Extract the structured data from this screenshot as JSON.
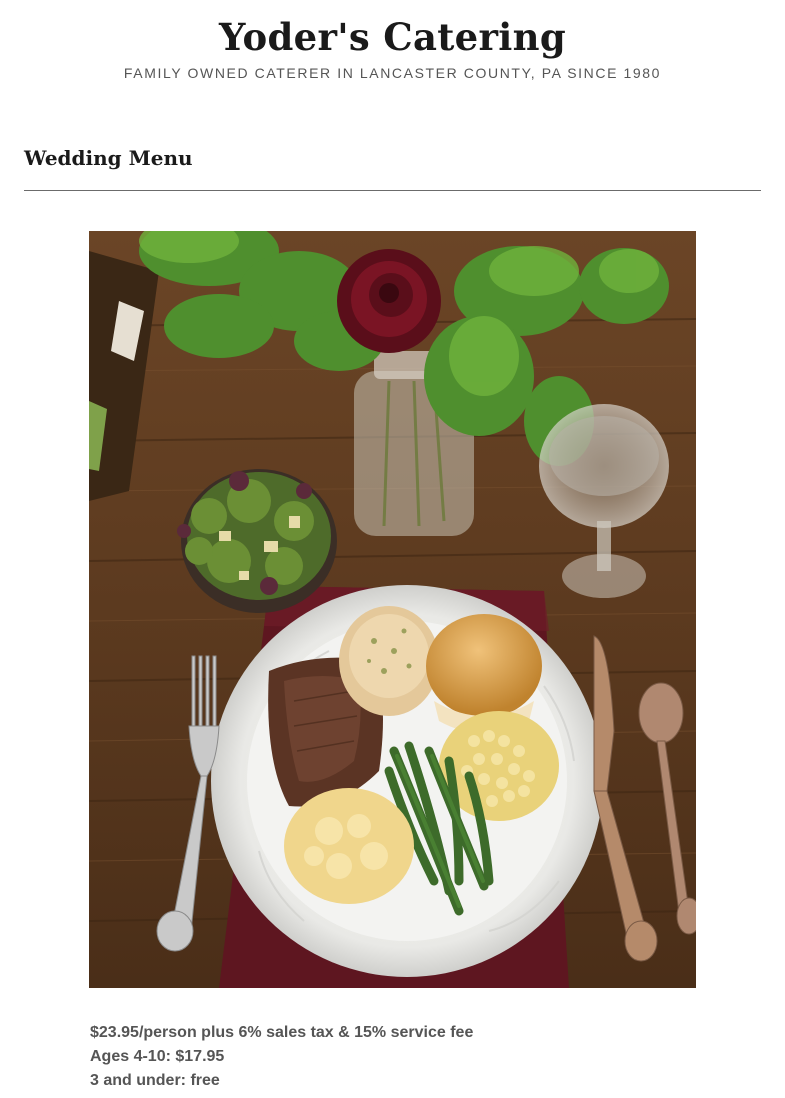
{
  "header": {
    "title": "Yoder's Catering",
    "tagline": "FAMILY OWNED CATERER IN LANCASTER COUNTY, PA SINCE 1980"
  },
  "section": {
    "title": "Wedding Menu"
  },
  "pricing": {
    "line1": "$23.95/person plus 6% sales tax & 15% service fee",
    "line2": "Ages 4-10: $17.95",
    "line3": "3 and under: free"
  }
}
